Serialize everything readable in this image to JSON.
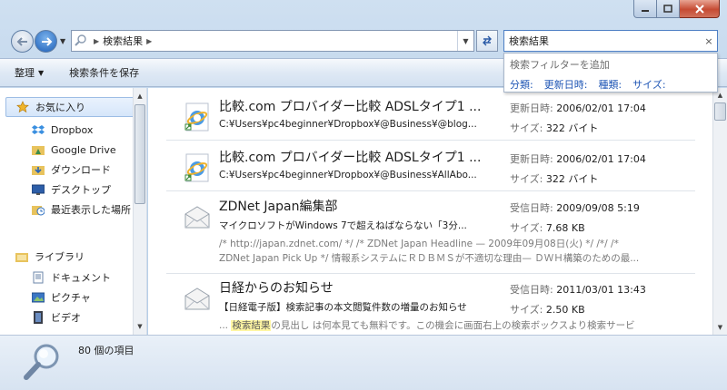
{
  "address": {
    "crumbs": [
      "検索結果"
    ],
    "search_value": "検索結果",
    "search_clear": "×"
  },
  "search_popup": {
    "header": "検索フィルターを追加",
    "filters": [
      "分類:",
      "更新日時:",
      "種類:",
      "サイズ:"
    ]
  },
  "toolbar": {
    "organize": "整理",
    "save_search": "検索条件を保存"
  },
  "navpane": {
    "favorites": "お気に入り",
    "items": [
      "Dropbox",
      "Google Drive",
      "ダウンロード",
      "デスクトップ",
      "最近表示した場所"
    ],
    "libraries": "ライブラリ",
    "lib_items": [
      "ドキュメント",
      "ピクチャ",
      "ビデオ"
    ]
  },
  "results": [
    {
      "icon": "ie-shortcut-icon",
      "title": "比較.com プロバイダー比較 ADSLタイプ1 ...",
      "line2": "C:¥Users¥pc4beginner¥Dropbox¥@Business¥@blog...",
      "meta1_label": "更新日時:",
      "meta1_value": "2006/02/01 17:04",
      "meta2_label": "サイズ:",
      "meta2_value": "322 バイト"
    },
    {
      "icon": "ie-shortcut-icon",
      "title": "比較.com プロバイダー比較 ADSLタイプ1 ...",
      "line2": "C:¥Users¥pc4beginner¥Dropbox¥@Business¥AllAbo...",
      "meta1_label": "更新日時:",
      "meta1_value": "2006/02/01 17:04",
      "meta2_label": "サイズ:",
      "meta2_value": "322 バイト"
    },
    {
      "icon": "mail-icon",
      "title": "ZDNet Japan編集部",
      "line2": "マイクロソフトがWindows 7で超えねばならない「3分...",
      "snippet1": "/* http://japan.zdnet.com/ */ /* ZDNet Japan Headline — 2009年09月08日(火) */ /*/ /*",
      "snippet2": "ZDNet Japan Pick Up */ 情報系システムにＲＤＢＭＳが不適切な理由— ＤＷＨ構築のための最...",
      "meta1_label": "受信日時:",
      "meta1_value": "2009/09/08 5:19",
      "meta2_label": "サイズ:",
      "meta2_value": "7.68 KB"
    },
    {
      "icon": "mail-icon",
      "title": "日経からのお知らせ",
      "line2": "【日経電子版】検索記事の本文閲覧件数の増量のお知らせ",
      "snippet_pre": "... ",
      "snippet_hl": "検索結果",
      "snippet_post": "の見出し は何本見ても無料です。この機会に画面右上の検索ボックスより検索サービ",
      "meta1_label": "受信日時:",
      "meta1_value": "2011/03/01 13:43",
      "meta2_label": "サイズ:",
      "meta2_value": "2.50 KB"
    }
  ],
  "status": {
    "count_text": "80 個の項目"
  }
}
